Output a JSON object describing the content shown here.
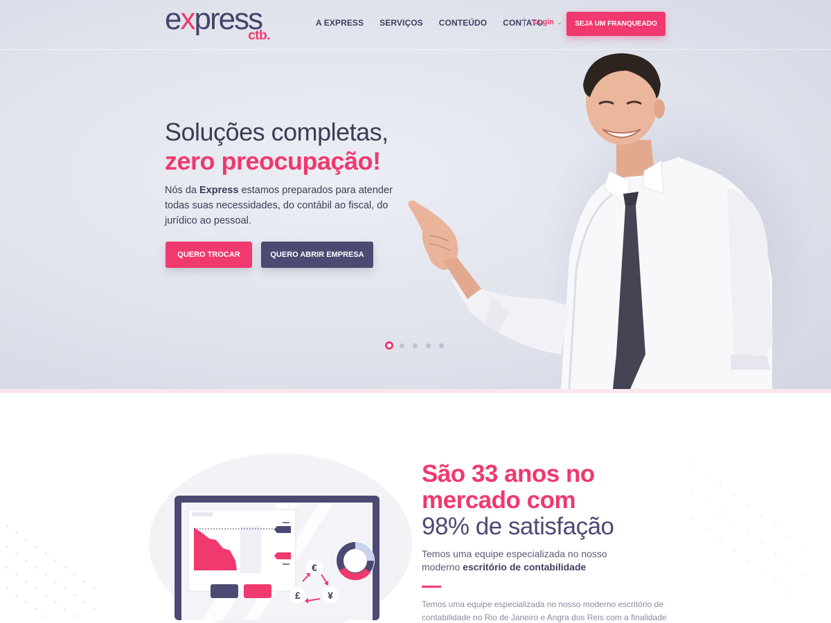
{
  "header": {
    "logo_main_1": "e",
    "logo_main_x": "x",
    "logo_main_2": "press",
    "logo_sub": "ctb.",
    "nav": [
      {
        "label": "A EXPRESS"
      },
      {
        "label": "SERVIÇOS"
      },
      {
        "label": "CONTEÚDO"
      },
      {
        "label": "CONTATO"
      }
    ],
    "login_label": "Login",
    "login_chevron": "⌄",
    "franchise_button": "SEJA UM FRANQUEADO"
  },
  "hero": {
    "title_line1": "Soluções completas,",
    "title_line2": "zero preocupação!",
    "text_pre": "Nós da ",
    "text_brand": "Express",
    "text_post": " estamos preparados para atender todas suas necessidades, do contábil ao fiscal, do jurídico ao pessoal.",
    "button_primary": "QUERO TROCAR",
    "button_secondary": "QUERO ABRIR EMPRESA",
    "slider": {
      "count": 5,
      "active_index": 0
    }
  },
  "about": {
    "title_line1": "São 33 anos no",
    "title_line2": "mercado com",
    "title_line3": "98% de satisfação",
    "subtitle_line1": "Temos uma equipe especializada no nosso",
    "subtitle_line2_pre": "moderno ",
    "subtitle_line2_bold": "escritório de contabilidade",
    "body_line1": "Temos uma equipe especializada no nosso moderno escritório de",
    "body_line2": "contabilidade no Rio de Janeiro e Angra dos Reis com a finalidade",
    "currency_symbols": [
      "€",
      "£",
      "¥"
    ]
  },
  "colors": {
    "accent": "#f0396e",
    "dark": "#4b4a72",
    "text": "#3c3c55"
  },
  "icons": [
    "chevron-down-icon",
    "euro-icon",
    "pound-icon",
    "yen-icon",
    "donut-chart-icon"
  ]
}
